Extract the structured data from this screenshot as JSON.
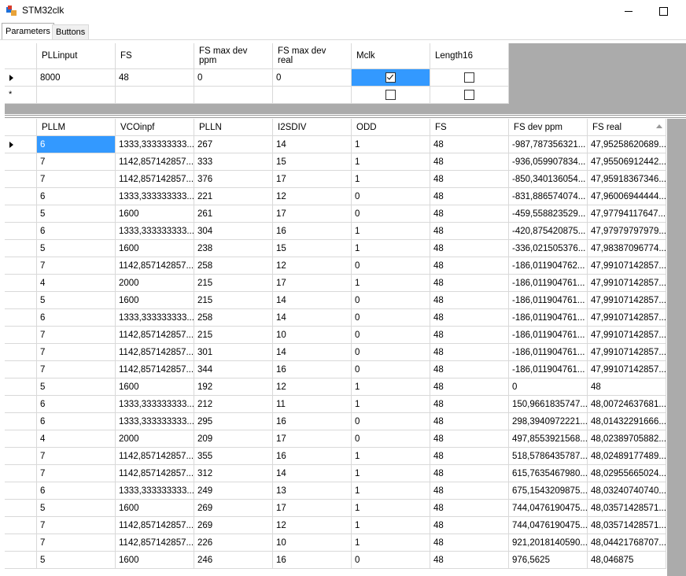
{
  "window": {
    "title": "STM32clk"
  },
  "tabs": [
    {
      "label": "Parameters"
    },
    {
      "label": "Buttons"
    }
  ],
  "params": {
    "headers": [
      "PLLinput",
      "FS",
      "FS max dev\nppm",
      "FS max dev\nreal",
      "Mclk",
      "Length16"
    ],
    "row": {
      "plllinput": "8000",
      "fs": "48",
      "ppm": "0",
      "real": "0",
      "mclk": true,
      "length16": false
    },
    "new_row": {
      "mclk": false,
      "length16": false
    }
  },
  "results": {
    "headers": [
      "PLLM",
      "VCOinpf",
      "PLLN",
      "I2SDIV",
      "ODD",
      "FS",
      "FS dev ppm",
      "FS real"
    ],
    "rows": [
      [
        "6",
        "1333,333333333...",
        "267",
        "14",
        "1",
        "48",
        "-987,787356321...",
        "47,95258620689..."
      ],
      [
        "7",
        "1142,857142857...",
        "333",
        "15",
        "1",
        "48",
        "-936,059907834...",
        "47,95506912442..."
      ],
      [
        "7",
        "1142,857142857...",
        "376",
        "17",
        "1",
        "48",
        "-850,340136054...",
        "47,95918367346..."
      ],
      [
        "6",
        "1333,333333333...",
        "221",
        "12",
        "0",
        "48",
        "-831,886574074...",
        "47,96006944444..."
      ],
      [
        "5",
        "1600",
        "261",
        "17",
        "0",
        "48",
        "-459,558823529...",
        "47,97794117647..."
      ],
      [
        "6",
        "1333,333333333...",
        "304",
        "16",
        "1",
        "48",
        "-420,875420875...",
        "47,97979797979..."
      ],
      [
        "5",
        "1600",
        "238",
        "15",
        "1",
        "48",
        "-336,021505376...",
        "47,98387096774..."
      ],
      [
        "7",
        "1142,857142857...",
        "258",
        "12",
        "0",
        "48",
        "-186,011904762...",
        "47,99107142857..."
      ],
      [
        "4",
        "2000",
        "215",
        "17",
        "1",
        "48",
        "-186,011904761...",
        "47,99107142857..."
      ],
      [
        "5",
        "1600",
        "215",
        "14",
        "0",
        "48",
        "-186,011904761...",
        "47,99107142857..."
      ],
      [
        "6",
        "1333,333333333...",
        "258",
        "14",
        "0",
        "48",
        "-186,011904761...",
        "47,99107142857..."
      ],
      [
        "7",
        "1142,857142857...",
        "215",
        "10",
        "0",
        "48",
        "-186,011904761...",
        "47,99107142857..."
      ],
      [
        "7",
        "1142,857142857...",
        "301",
        "14",
        "0",
        "48",
        "-186,011904761...",
        "47,99107142857..."
      ],
      [
        "7",
        "1142,857142857...",
        "344",
        "16",
        "0",
        "48",
        "-186,011904761...",
        "47,99107142857..."
      ],
      [
        "5",
        "1600",
        "192",
        "12",
        "1",
        "48",
        "0",
        "48"
      ],
      [
        "6",
        "1333,333333333...",
        "212",
        "11",
        "1",
        "48",
        "150,9661835747...",
        "48,00724637681..."
      ],
      [
        "6",
        "1333,333333333...",
        "295",
        "16",
        "0",
        "48",
        "298,3940972221...",
        "48,01432291666..."
      ],
      [
        "4",
        "2000",
        "209",
        "17",
        "0",
        "48",
        "497,8553921568...",
        "48,02389705882..."
      ],
      [
        "7",
        "1142,857142857...",
        "355",
        "16",
        "1",
        "48",
        "518,5786435787...",
        "48,02489177489..."
      ],
      [
        "7",
        "1142,857142857...",
        "312",
        "14",
        "1",
        "48",
        "615,7635467980...",
        "48,02955665024..."
      ],
      [
        "6",
        "1333,333333333...",
        "249",
        "13",
        "1",
        "48",
        "675,1543209875...",
        "48,03240740740..."
      ],
      [
        "5",
        "1600",
        "269",
        "17",
        "1",
        "48",
        "744,0476190475...",
        "48,03571428571..."
      ],
      [
        "7",
        "1142,857142857...",
        "269",
        "12",
        "1",
        "48",
        "744,0476190475...",
        "48,03571428571..."
      ],
      [
        "7",
        "1142,857142857...",
        "226",
        "10",
        "1",
        "48",
        "921,2018140590...",
        "48,04421768707..."
      ],
      [
        "5",
        "1600",
        "246",
        "16",
        "0",
        "48",
        "976,5625",
        "48,046875"
      ]
    ]
  }
}
